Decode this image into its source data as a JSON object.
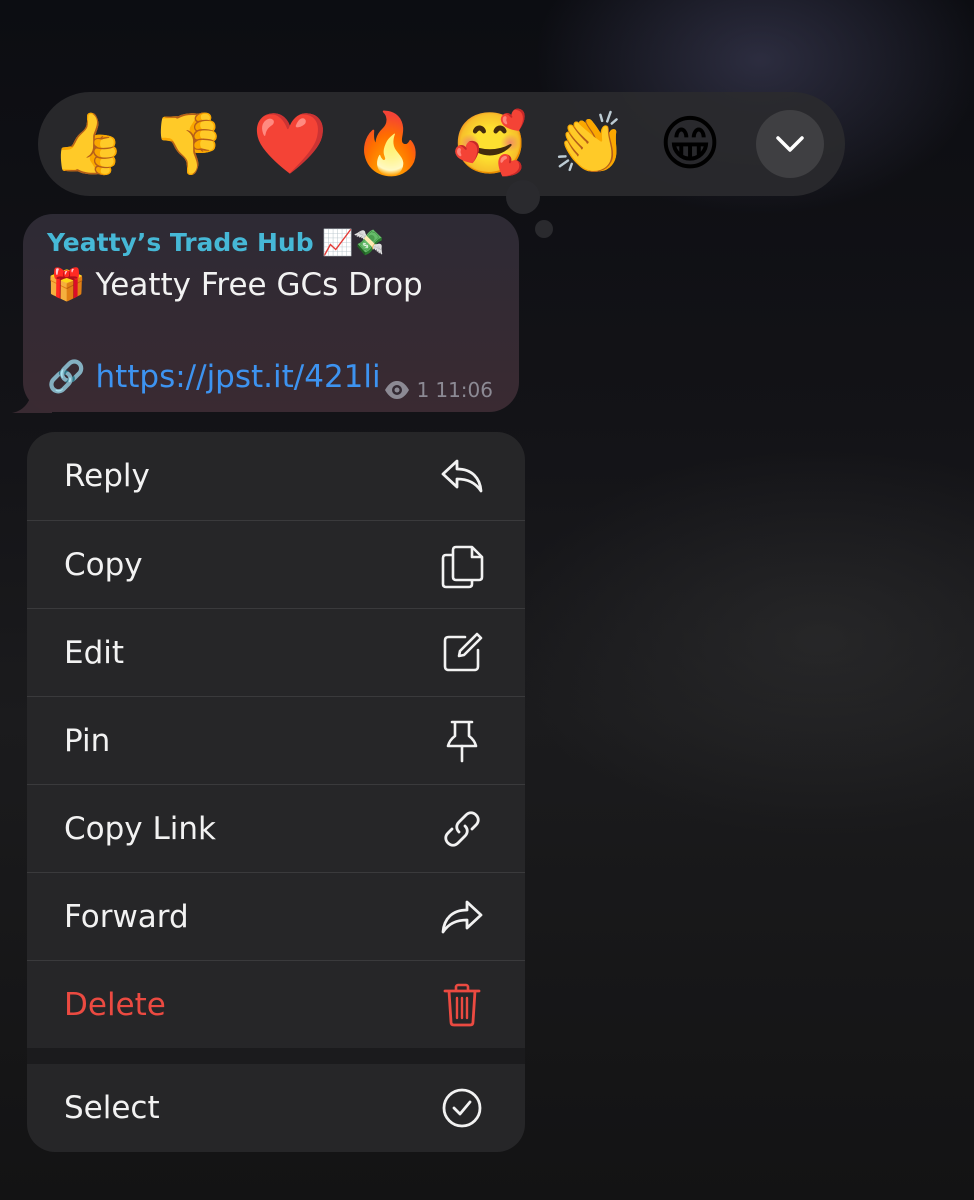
{
  "reactions": {
    "items": [
      {
        "emoji": "👍",
        "name": "thumbs-up"
      },
      {
        "emoji": "👎",
        "name": "thumbs-down"
      },
      {
        "emoji": "❤️",
        "name": "red-heart"
      },
      {
        "emoji": "🔥",
        "name": "fire"
      },
      {
        "emoji": "🥰",
        "name": "smiling-face-with-hearts"
      },
      {
        "emoji": "👏",
        "name": "clapping-hands"
      },
      {
        "emoji": "😁",
        "name": "beaming-face"
      }
    ],
    "expand_icon": "chevron-down-icon"
  },
  "message": {
    "sender": "Yeatty’s Trade Hub 📈💸",
    "title": "🎁 Yeatty Free GCs Drop",
    "link": "🔗 https://jpst.it/421li",
    "views": "1",
    "time": "11:06",
    "view_icon": "eye-icon"
  },
  "menu": {
    "items": [
      {
        "label": "Reply",
        "icon": "reply-icon"
      },
      {
        "label": "Copy",
        "icon": "copy-icon"
      },
      {
        "label": "Edit",
        "icon": "edit-icon"
      },
      {
        "label": "Pin",
        "icon": "pin-icon"
      },
      {
        "label": "Copy Link",
        "icon": "link-icon"
      },
      {
        "label": "Forward",
        "icon": "forward-icon"
      },
      {
        "label": "Delete",
        "icon": "trash-icon"
      }
    ],
    "secondary_items": [
      {
        "label": "Select",
        "icon": "checkmark-circle-icon"
      }
    ]
  },
  "colors": {
    "accent_link": "#3d93f0",
    "sender": "#46b8d6",
    "destructive": "#eb4a41"
  }
}
